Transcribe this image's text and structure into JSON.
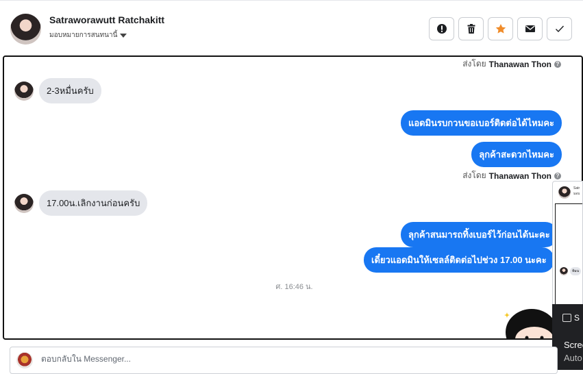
{
  "header": {
    "name": "Satraworawutt Ratchakitt",
    "assign_label": "มอบหมายการสนทนานี้",
    "actions": {
      "alert_icon": "exclamation-circle-icon",
      "trash_icon": "trash-icon",
      "star_icon": "star-icon",
      "mail_icon": "envelope-icon",
      "check_icon": "check-icon"
    }
  },
  "thread": {
    "sent_by_prefix": "ส่งโดย",
    "sent_by_name": "Thanawan Thon",
    "messages": [
      {
        "dir": "in",
        "text": "2-3หมื่นครับ"
      },
      {
        "dir": "out",
        "text": "แอดมินรบกวนขอเบอร์ติดต่อได้ไหมคะ"
      },
      {
        "dir": "out",
        "text": "ลุกค้าสะดวกไหมคะ"
      },
      {
        "dir": "in",
        "text": "17.00น.เลิกงานก่อนครับ"
      },
      {
        "dir": "out",
        "text": "ลุกค้าสนมารถทิ้งเบอร์ไว้ก่อนได้นะคะ"
      },
      {
        "dir": "out",
        "text": "เดี๋ยวแอดมินให้เซลล์ติดต่อไปช่วง 17.00 นะคะ"
      }
    ],
    "timestamp": "ศ. 16:46 น."
  },
  "composer": {
    "placeholder": "ตอบกลับใน Messenger..."
  },
  "overlay": {
    "popup_name": "Satr",
    "popup_sub": "มอบ",
    "popup_msg": "ห้มน",
    "toast_label": "S",
    "toast_title": "Scree",
    "toast_sub": "Auto"
  },
  "colors": {
    "outgoing_bubble": "#1877f2",
    "incoming_bubble": "#e4e6eb",
    "star": "#f08c2a"
  }
}
